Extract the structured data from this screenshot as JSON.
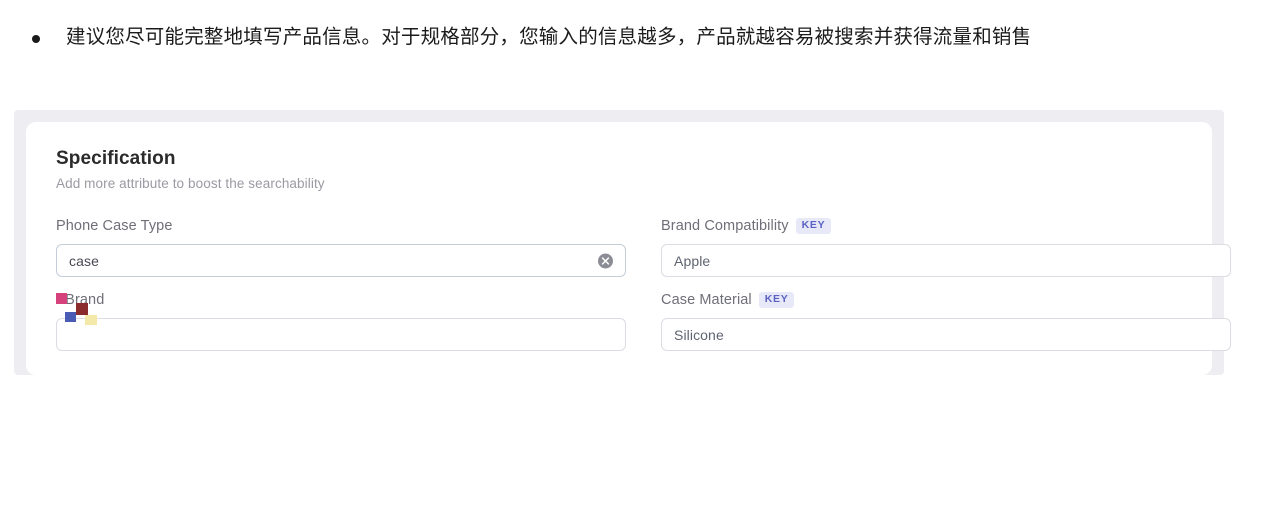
{
  "note": {
    "bullet_icon": "bullet-dot",
    "text": "建议您尽可能完整地填写产品信息。对于规格部分，您输入的信息越多，产品就越容易被搜索并获得流量和销售"
  },
  "specification": {
    "title": "Specification",
    "subtitle": "Add more attribute to boost the searchability",
    "key_badge_label": "KEY",
    "required_marker": "*",
    "fields": [
      {
        "label": "Phone Case Type",
        "value": "case",
        "placeholder": "",
        "required": false,
        "key_badge": false,
        "has_clear": true,
        "clear_icon": "clear-circle-x-icon",
        "focused": true
      },
      {
        "label": "Brand Compatibility",
        "value": "Apple",
        "placeholder": "",
        "required": false,
        "key_badge": true,
        "has_clear": false,
        "focused": false
      },
      {
        "label": "Brand",
        "value": "",
        "placeholder": "",
        "required": true,
        "key_badge": false,
        "has_clear": false,
        "focused": false
      },
      {
        "label": "Case Material",
        "value": "Silicone",
        "placeholder": "",
        "required": false,
        "key_badge": true,
        "has_clear": false,
        "focused": false
      }
    ]
  },
  "colors": {
    "panel_background": "#eeeef2",
    "card_background": "#ffffff",
    "label_text": "#6f6f79",
    "title_text": "#2b2b2b",
    "subtitle_text": "#9a9aa3",
    "key_badge_bg": "#e8e9f8",
    "key_badge_text": "#5b62c4",
    "input_border": "#dcdce3",
    "clear_icon": "#8c8c96"
  },
  "artifact_swatches": [
    "#d6427c",
    "#8c2b2b",
    "#4a5bb5",
    "#f4e9a8"
  ]
}
